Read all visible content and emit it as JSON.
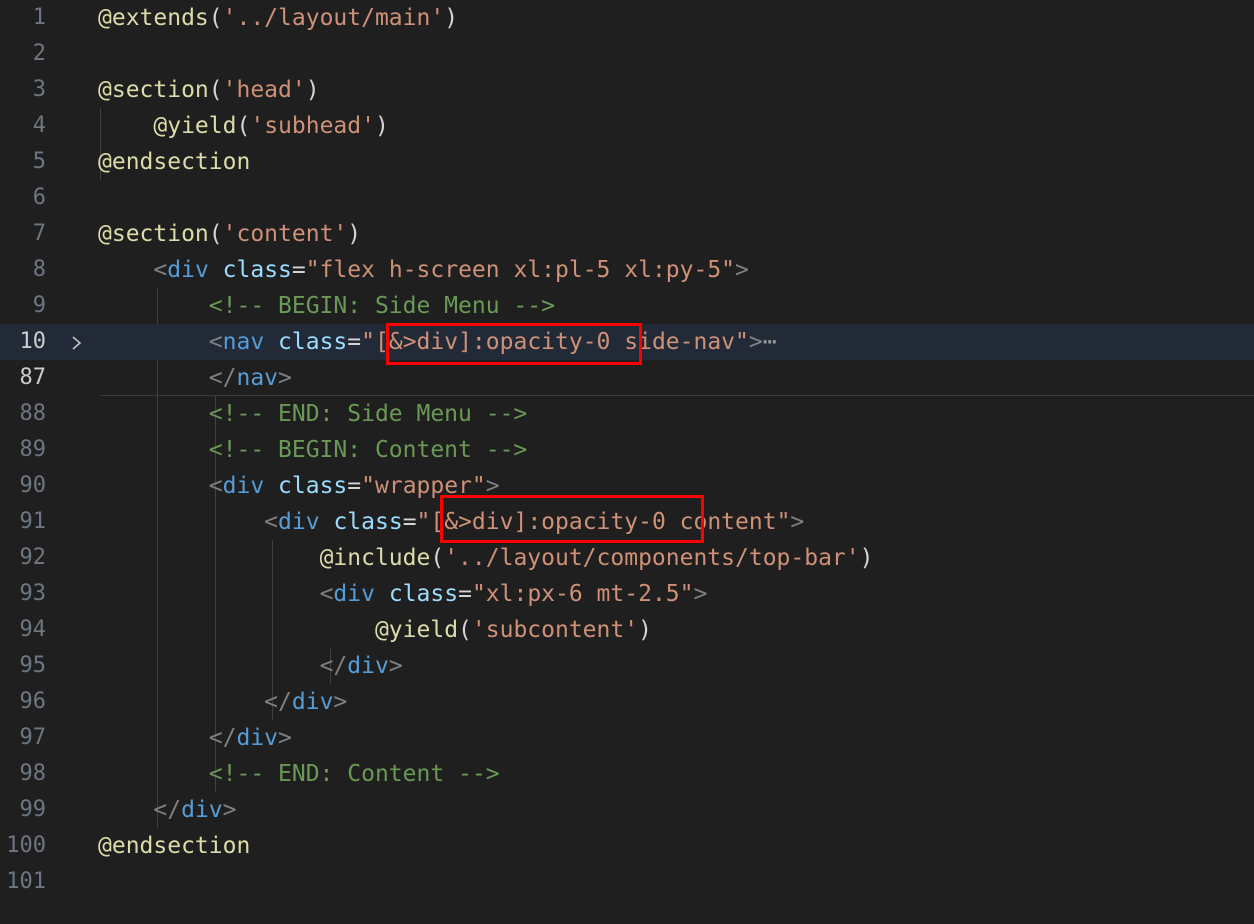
{
  "editor": {
    "language": "blade",
    "lines": [
      {
        "num": "1",
        "tokens": [
          [
            "dir",
            "@extends"
          ],
          [
            "plain",
            "("
          ],
          [
            "str",
            "'../layout/main'"
          ],
          [
            "plain",
            ")"
          ]
        ]
      },
      {
        "num": "2",
        "tokens": []
      },
      {
        "num": "3",
        "tokens": [
          [
            "dir",
            "@section"
          ],
          [
            "plain",
            "("
          ],
          [
            "str",
            "'head'"
          ],
          [
            "plain",
            ")"
          ]
        ]
      },
      {
        "num": "4",
        "tokens": [
          [
            "plain",
            "    "
          ],
          [
            "dir",
            "@yield"
          ],
          [
            "plain",
            "("
          ],
          [
            "str",
            "'subhead'"
          ],
          [
            "plain",
            ")"
          ]
        ]
      },
      {
        "num": "5",
        "tokens": [
          [
            "dir",
            "@endsection"
          ]
        ]
      },
      {
        "num": "6",
        "tokens": []
      },
      {
        "num": "7",
        "tokens": [
          [
            "dir",
            "@section"
          ],
          [
            "plain",
            "("
          ],
          [
            "str",
            "'content'"
          ],
          [
            "plain",
            ")"
          ]
        ]
      },
      {
        "num": "8",
        "tokens": [
          [
            "plain",
            "    "
          ],
          [
            "punc",
            "<"
          ],
          [
            "tag",
            "div"
          ],
          [
            "plain",
            " "
          ],
          [
            "attr",
            "class"
          ],
          [
            "plain",
            "="
          ],
          [
            "str",
            "\"flex h-screen xl:pl-5 xl:py-5\""
          ],
          [
            "punc",
            ">"
          ]
        ]
      },
      {
        "num": "9",
        "tokens": [
          [
            "plain",
            "        "
          ],
          [
            "cmt",
            "<!-- BEGIN: Side Menu -->"
          ]
        ]
      },
      {
        "num": "10",
        "tokens": [
          [
            "plain",
            "        "
          ],
          [
            "punc",
            "<"
          ],
          [
            "tag",
            "nav"
          ],
          [
            "plain",
            " "
          ],
          [
            "attr",
            "class"
          ],
          [
            "plain",
            "="
          ],
          [
            "str",
            "\"[&>div]:opacity-0 side-nav\""
          ],
          [
            "punc",
            ">"
          ],
          [
            "ellipsis",
            "⋯"
          ]
        ]
      },
      {
        "num": "87",
        "tokens": [
          [
            "plain",
            "        "
          ],
          [
            "punc",
            "</"
          ],
          [
            "tag",
            "nav"
          ],
          [
            "punc",
            ">"
          ]
        ]
      },
      {
        "num": "88",
        "tokens": [
          [
            "plain",
            "        "
          ],
          [
            "cmt",
            "<!-- END: Side Menu -->"
          ]
        ]
      },
      {
        "num": "89",
        "tokens": [
          [
            "plain",
            "        "
          ],
          [
            "cmt",
            "<!-- BEGIN: Content -->"
          ]
        ]
      },
      {
        "num": "90",
        "tokens": [
          [
            "plain",
            "        "
          ],
          [
            "punc",
            "<"
          ],
          [
            "tag",
            "div"
          ],
          [
            "plain",
            " "
          ],
          [
            "attr",
            "class"
          ],
          [
            "plain",
            "="
          ],
          [
            "str",
            "\"wrapper\""
          ],
          [
            "punc",
            ">"
          ]
        ]
      },
      {
        "num": "91",
        "tokens": [
          [
            "plain",
            "            "
          ],
          [
            "punc",
            "<"
          ],
          [
            "tag",
            "div"
          ],
          [
            "plain",
            " "
          ],
          [
            "attr",
            "class"
          ],
          [
            "plain",
            "="
          ],
          [
            "str",
            "\"[&>div]:opacity-0 content\""
          ],
          [
            "punc",
            ">"
          ]
        ]
      },
      {
        "num": "92",
        "tokens": [
          [
            "plain",
            "                "
          ],
          [
            "dir",
            "@include"
          ],
          [
            "plain",
            "("
          ],
          [
            "str",
            "'../layout/components/top-bar'"
          ],
          [
            "plain",
            ")"
          ]
        ]
      },
      {
        "num": "93",
        "tokens": [
          [
            "plain",
            "                "
          ],
          [
            "punc",
            "<"
          ],
          [
            "tag",
            "div"
          ],
          [
            "plain",
            " "
          ],
          [
            "attr",
            "class"
          ],
          [
            "plain",
            "="
          ],
          [
            "str",
            "\"xl:px-6 mt-2.5\""
          ],
          [
            "punc",
            ">"
          ]
        ]
      },
      {
        "num": "94",
        "tokens": [
          [
            "plain",
            "                    "
          ],
          [
            "dir",
            "@yield"
          ],
          [
            "plain",
            "("
          ],
          [
            "str",
            "'subcontent'"
          ],
          [
            "plain",
            ")"
          ]
        ]
      },
      {
        "num": "95",
        "tokens": [
          [
            "plain",
            "                "
          ],
          [
            "punc",
            "</"
          ],
          [
            "tag",
            "div"
          ],
          [
            "punc",
            ">"
          ]
        ]
      },
      {
        "num": "96",
        "tokens": [
          [
            "plain",
            "            "
          ],
          [
            "punc",
            "</"
          ],
          [
            "tag",
            "div"
          ],
          [
            "punc",
            ">"
          ]
        ]
      },
      {
        "num": "97",
        "tokens": [
          [
            "plain",
            "        "
          ],
          [
            "punc",
            "</"
          ],
          [
            "tag",
            "div"
          ],
          [
            "punc",
            ">"
          ]
        ]
      },
      {
        "num": "98",
        "tokens": [
          [
            "plain",
            "        "
          ],
          [
            "cmt",
            "<!-- END: Content -->"
          ]
        ]
      },
      {
        "num": "99",
        "tokens": [
          [
            "plain",
            "    "
          ],
          [
            "punc",
            "</"
          ],
          [
            "tag",
            "div"
          ],
          [
            "punc",
            ">"
          ]
        ]
      },
      {
        "num": "100",
        "tokens": [
          [
            "dir",
            "@endsection"
          ]
        ]
      },
      {
        "num": "101",
        "tokens": []
      }
    ],
    "current_line": "10",
    "cursor_line": "87",
    "folded_line": "10",
    "fold_icon": "chevron-right-icon",
    "highlight_color": "#ff0000"
  }
}
